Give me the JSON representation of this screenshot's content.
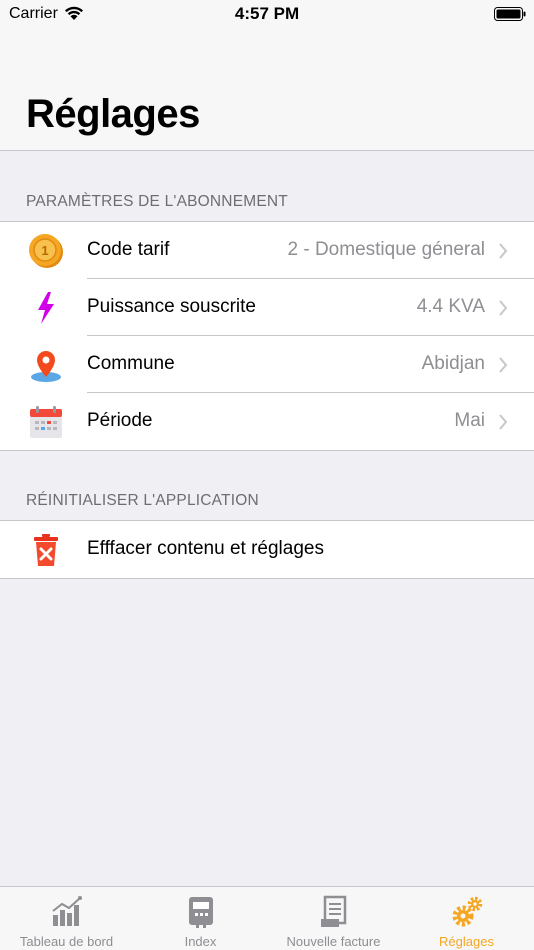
{
  "status_bar": {
    "carrier": "Carrier",
    "time": "4:57 PM"
  },
  "page_title": "Réglages",
  "subscription": {
    "header": "PARAMÈTRES DE L'ABONNEMENT",
    "rows": [
      {
        "label": "Code tarif",
        "value": "2 - Domestique géneral",
        "icon": "coin-icon"
      },
      {
        "label": "Puissance souscrite",
        "value": "4.4 KVA",
        "icon": "lightning-icon"
      },
      {
        "label": "Commune",
        "value": "Abidjan",
        "icon": "location-pin-icon"
      },
      {
        "label": "Période",
        "value": "Mai",
        "icon": "calendar-icon"
      }
    ]
  },
  "reset": {
    "header": "RÉINITIALISER L'APPLICATION",
    "rows": [
      {
        "label": "Efffacer contenu et réglages",
        "icon": "trash-icon"
      }
    ]
  },
  "tabs": [
    {
      "label": "Tableau de bord",
      "icon": "chart-icon",
      "active": false
    },
    {
      "label": "Index",
      "icon": "meter-icon",
      "active": false
    },
    {
      "label": "Nouvelle facture",
      "icon": "invoice-icon",
      "active": false
    },
    {
      "label": "Réglages",
      "icon": "gears-icon",
      "active": true
    }
  ],
  "colors": {
    "accent": "#f5a623",
    "inactive": "#8e8e93",
    "separator": "#c8c7cc"
  }
}
